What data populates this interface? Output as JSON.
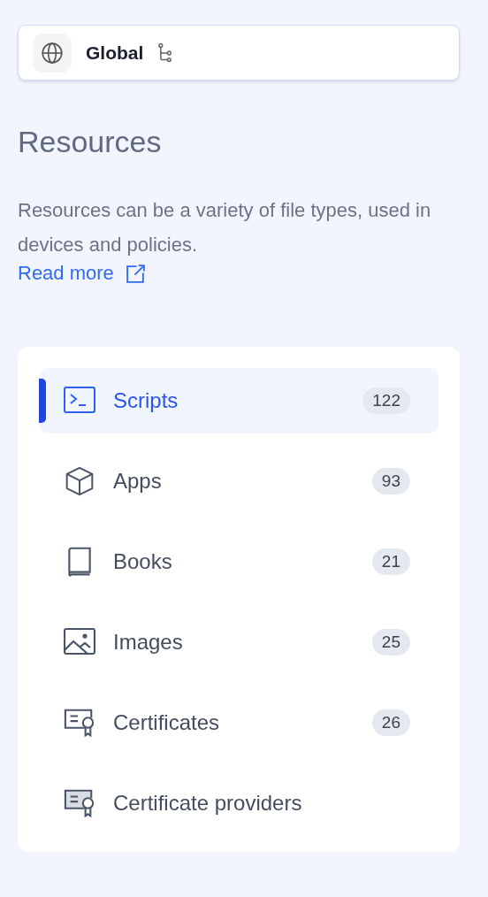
{
  "scope": {
    "label": "Global"
  },
  "heading": "Resources",
  "description": "Resources can be a variety of file types, used in devices and policies.",
  "read_more": "Read more",
  "items": [
    {
      "kind": "script",
      "label": "Scripts",
      "count": "122",
      "selected": true
    },
    {
      "kind": "app",
      "label": "Apps",
      "count": "93",
      "selected": false
    },
    {
      "kind": "book",
      "label": "Books",
      "count": "21",
      "selected": false
    },
    {
      "kind": "image",
      "label": "Images",
      "count": "25",
      "selected": false
    },
    {
      "kind": "certificate",
      "label": "Certificates",
      "count": "26",
      "selected": false
    },
    {
      "kind": "certificate-provider",
      "label": "Certificate providers",
      "selected": false
    }
  ]
}
